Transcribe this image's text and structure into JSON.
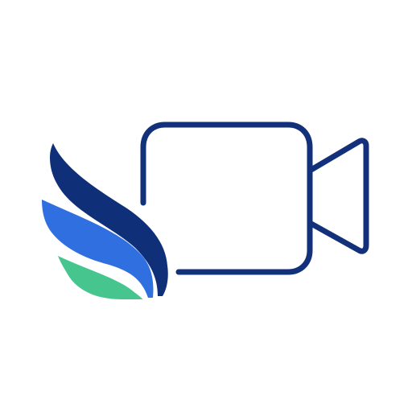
{
  "logo": {
    "name": "video-camera-wing-logo",
    "icon": "video-camera-icon",
    "colors": {
      "background": "#ffffff",
      "camera_outline": "#13317a",
      "wing_dark": "#0f2f78",
      "wing_blue": "#2f6fe0",
      "wing_green": "#47c58f"
    }
  }
}
